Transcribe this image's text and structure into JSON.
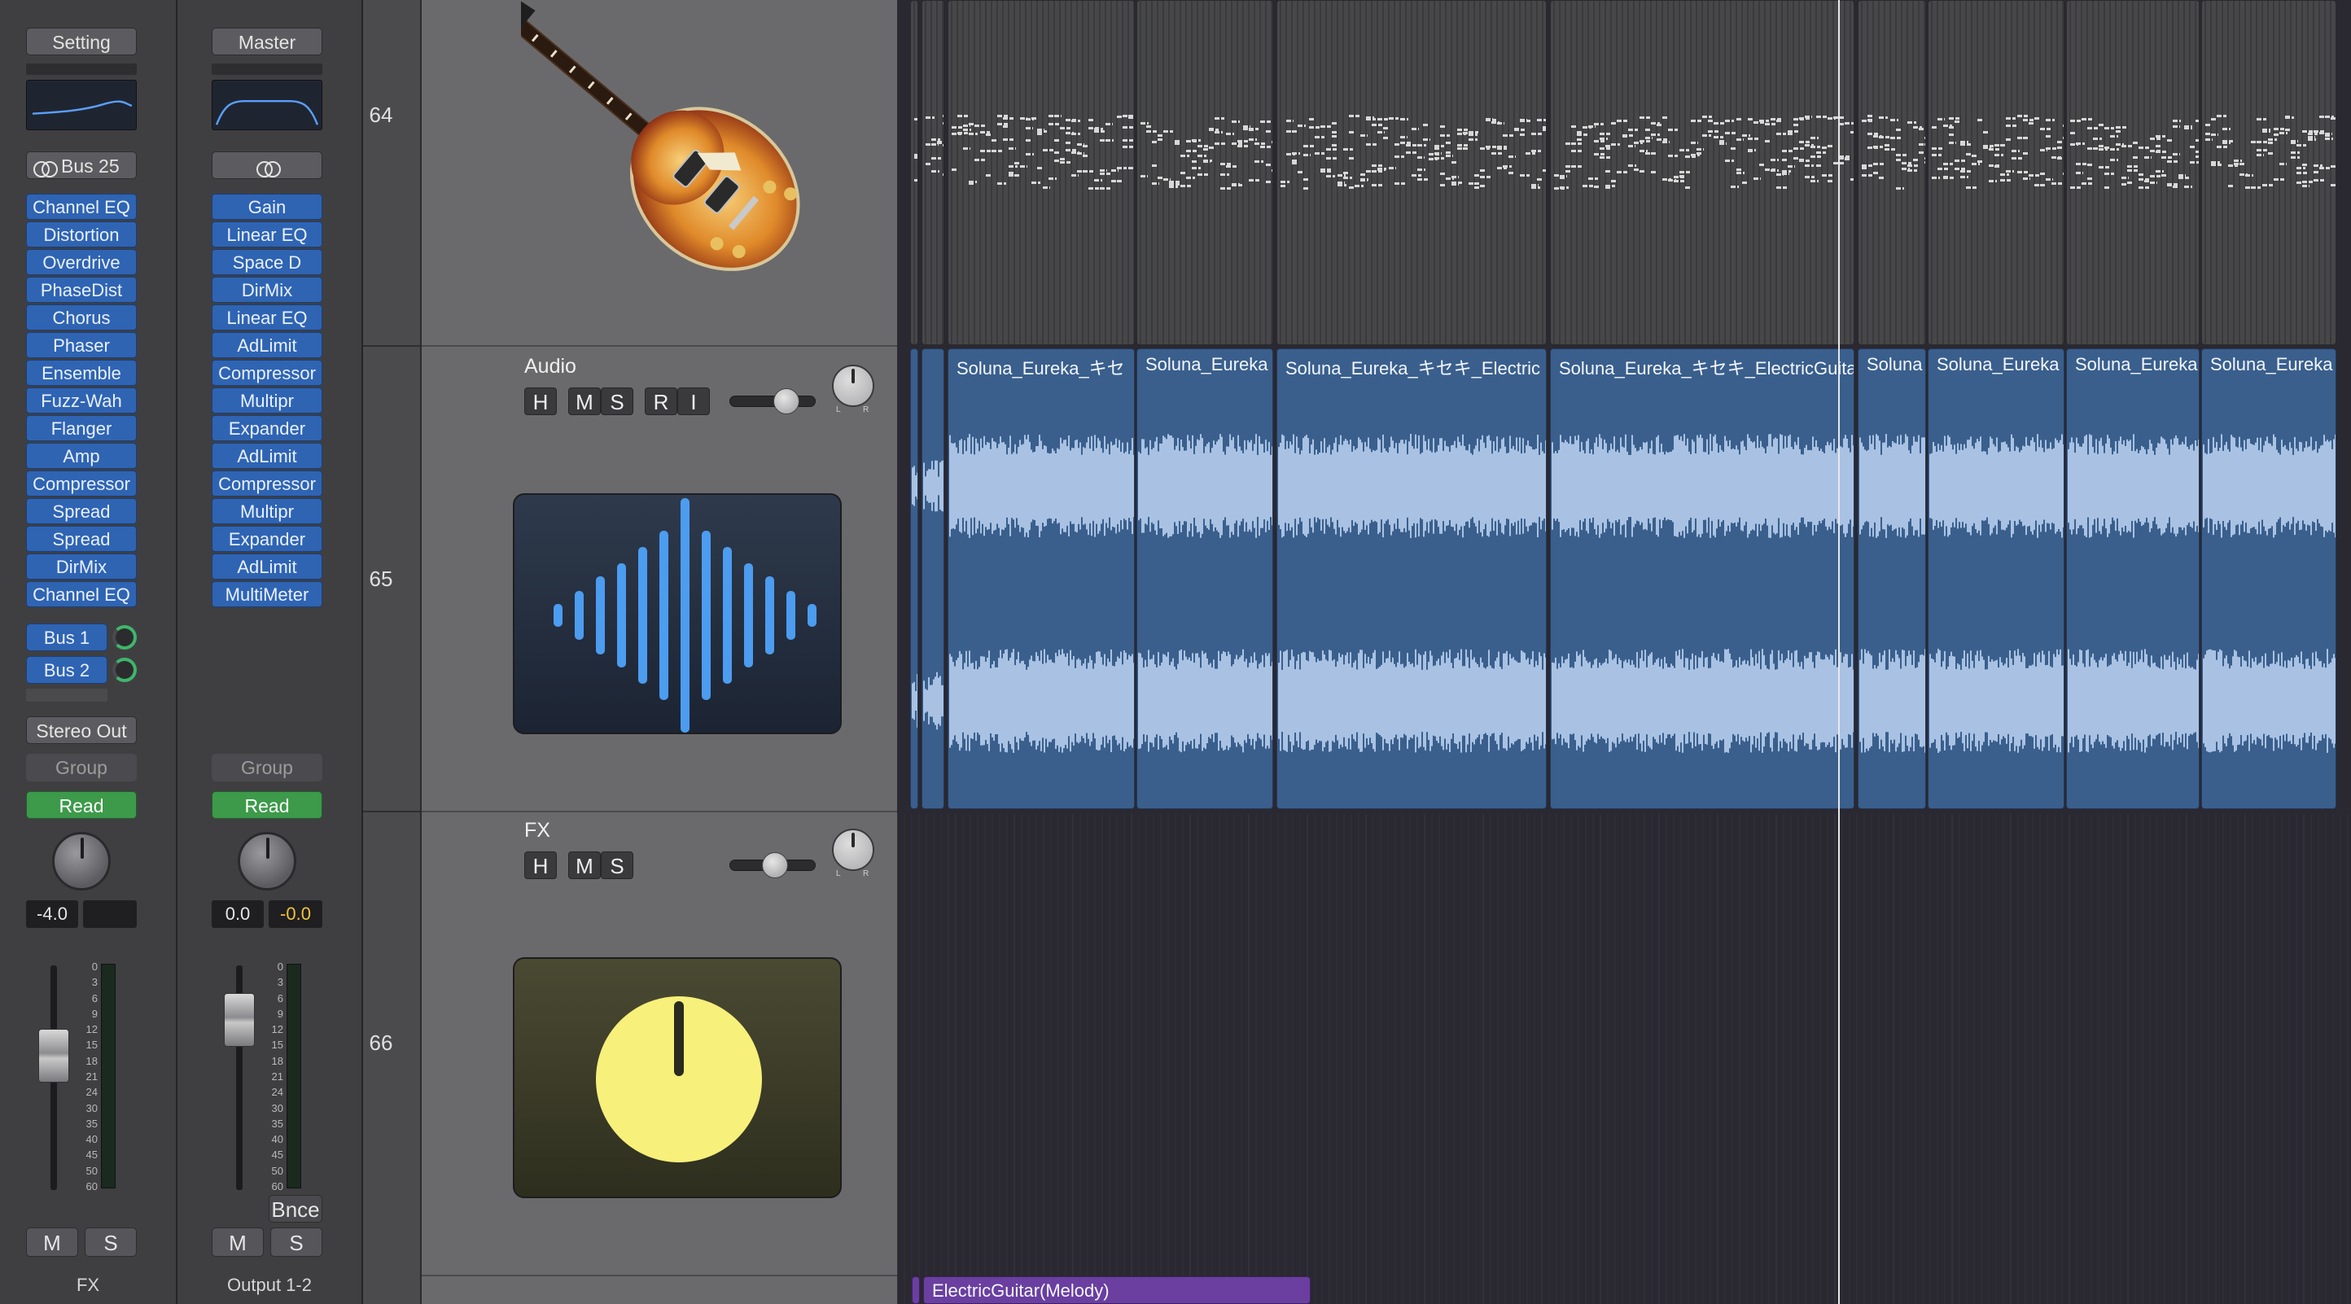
{
  "colors": {
    "plugin_blue": "#2f64b3",
    "read_green": "#3d9a4a",
    "audio_region": "#3a5f8c",
    "midi_region": "#474749",
    "fx_knob_yellow": "#f7f07a",
    "purple_region": "#6a3fa0"
  },
  "mixer": {
    "fx_strip": {
      "setting_label": "Setting",
      "bus_label": "Bus 25",
      "plugins": [
        "Channel EQ",
        "Distortion",
        "Overdrive",
        "PhaseDist",
        "Chorus",
        "Phaser",
        "Ensemble",
        "Fuzz-Wah",
        "Flanger",
        "Amp",
        "Compressor",
        "Spread",
        "Spread",
        "DirMix",
        "Channel EQ"
      ],
      "sends": [
        "Bus 1",
        "Bus 2"
      ],
      "output": "Stereo Out",
      "group": "Group",
      "automation": "Read",
      "volume": "-4.0",
      "peak": "",
      "mute": "M",
      "solo": "S",
      "name": "FX"
    },
    "master_strip": {
      "setting_label": "Master",
      "plugins": [
        "Gain",
        "Linear EQ",
        "Space D",
        "DirMix",
        "Linear EQ",
        "AdLimit",
        "Compressor",
        "Multipr",
        "Expander",
        "AdLimit",
        "Compressor",
        "Multipr",
        "Expander",
        "AdLimit",
        "MultiMeter"
      ],
      "group": "Group",
      "automation": "Read",
      "volume": "0.0",
      "peak": "-0.0",
      "bounce": "Bnce",
      "mute": "M",
      "solo": "S",
      "name": "Output 1-2"
    },
    "fader_scale": [
      "0",
      "3",
      "6",
      "9",
      "12",
      "15",
      "18",
      "21",
      "24",
      "30",
      "35",
      "40",
      "45",
      "50",
      "60"
    ]
  },
  "tracks": [
    {
      "number": "64",
      "icon": "guitar-icon"
    },
    {
      "number": "65",
      "name": "Audio",
      "buttons": [
        "H",
        "M",
        "S",
        "R",
        "I"
      ],
      "pan_labels": [
        "L",
        "R"
      ],
      "icon": "waveform-icon"
    },
    {
      "number": "66",
      "name": "FX",
      "buttons": [
        "H",
        "M",
        "S"
      ],
      "pan_labels": [
        "L",
        "R"
      ],
      "icon": "knob-icon"
    }
  ],
  "audio_regions": [
    {
      "label": ""
    },
    {
      "label": ""
    },
    {
      "label": "Soluna_Eureka_キセ"
    },
    {
      "label": "Soluna_Eureka"
    },
    {
      "label": "Soluna_Eureka_キセキ_Electric"
    },
    {
      "label": "Soluna_Eureka_キセキ_ElectricGuita"
    },
    {
      "label": "Soluna"
    },
    {
      "label": "Soluna_Eureka"
    },
    {
      "label": "Soluna_Eureka"
    },
    {
      "label": "Soluna_Eureka"
    }
  ],
  "bottom_region": {
    "label": "ElectricGuitar(Melody)"
  }
}
